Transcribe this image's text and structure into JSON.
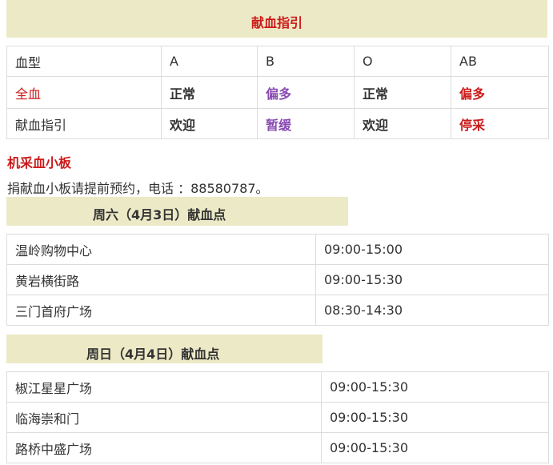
{
  "guide": {
    "title": "献血指引",
    "header": [
      "血型",
      "A",
      "B",
      "O",
      "AB"
    ],
    "rows": [
      [
        "全血",
        "正常",
        "偏多",
        "正常",
        "偏多"
      ],
      [
        "献血指引",
        "欢迎",
        "暂缓",
        "欢迎",
        "停采"
      ]
    ]
  },
  "platelet": {
    "title": "机采血小板",
    "note": "捐献血小板请提前预约，电话 ：88580787。"
  },
  "saturday": {
    "title": "周六（4月3日）献血点",
    "sites": [
      [
        "温岭购物中心",
        "09:00-15:00"
      ],
      [
        "黄岩横街路",
        "09:00-15:30"
      ],
      [
        "三门首府广场",
        "08:30-14:30"
      ]
    ]
  },
  "sunday": {
    "title": "周日（4月4日）献血点",
    "sites": [
      [
        "椒江星星广场",
        "09:00-15:30"
      ],
      [
        "临海崇和门",
        "09:00-15:30"
      ],
      [
        "路桥中盛广场",
        "09:00-15:30"
      ]
    ]
  },
  "colors": {
    "banner": "#ece9c6",
    "red": "#cc1a1a",
    "purple": "#8a4bb3",
    "text": "#333333"
  }
}
